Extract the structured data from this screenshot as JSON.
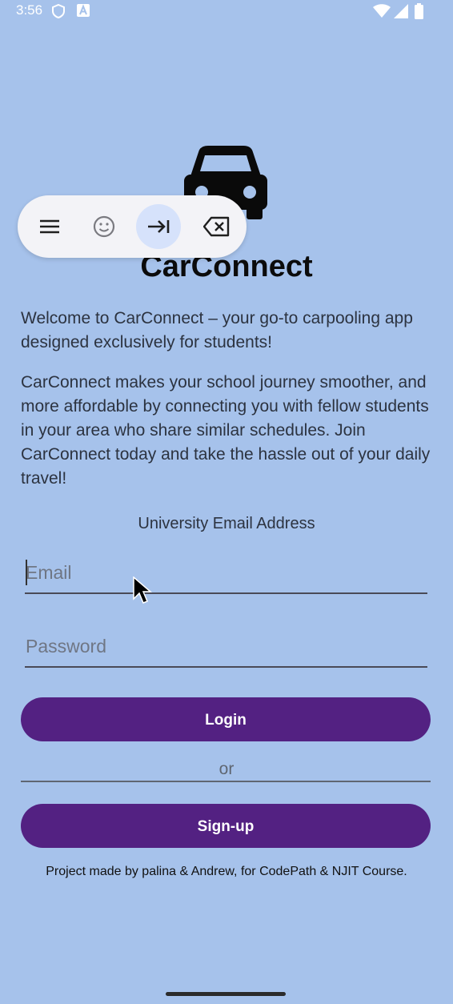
{
  "status_bar": {
    "time": "3:56"
  },
  "app": {
    "title": "CarConnect",
    "logo_icon": "car-icon",
    "intro": "Welcome to CarConnect – your go-to carpooling app designed exclusively for students!",
    "description": "CarConnect makes your school journey smoother, and more affordable by connecting you with fellow students in your area who share similar schedules. Join CarConnect today and take the hassle out of your daily travel!"
  },
  "form": {
    "email_label": "University Email Address",
    "email_placeholder": "Email",
    "email_value": "",
    "password_placeholder": "Password",
    "password_value": "",
    "login_label": "Login",
    "or_text": "or",
    "signup_label": "Sign-up"
  },
  "footer": {
    "credit": "Project made by palina & Andrew, for CodePath & NJIT Course."
  },
  "keyboard_toolbar": {
    "icons": [
      "menu-icon",
      "emoji-icon",
      "tab-icon",
      "backspace-icon"
    ]
  },
  "colors": {
    "background": "#a6c2eb",
    "button": "#532182",
    "button_text": "#ffffff"
  }
}
